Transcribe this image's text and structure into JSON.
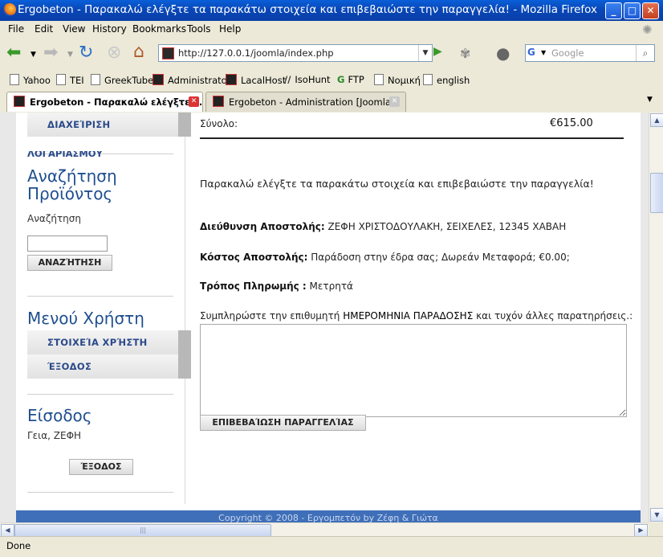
{
  "window": {
    "title": "Ergobeton - Παρακαλώ ελέγξτε τα παρακάτω στοιχεία και επιβεβαιώστε την παραγγελία! - Mozilla Firefox"
  },
  "menu": [
    "File",
    "Edit",
    "View",
    "History",
    "Bookmarks",
    "Tools",
    "Help"
  ],
  "toolbar": {
    "url": "http://127.0.0.1/joomla/index.php",
    "search_placeholder": "Google"
  },
  "bookmarks": [
    "Yahoo",
    "TEI",
    "GreekTube",
    "Administrator",
    "LacalHost",
    "IsoHunt",
    "FTP",
    "Νομική",
    "english"
  ],
  "tabs": [
    {
      "label": "Ergobeton - Παρακαλώ ελέγξτε τ...",
      "active": true
    },
    {
      "label": "Ergobeton - Administration [Joomla!]",
      "active": false
    }
  ],
  "sidebar": {
    "admin_label": "ΔΙΑΧΕΊΡΙΣΗ",
    "account_label": "ΛΟΓΑΡΙΑΣΜΟΥ",
    "search_title": "Αναζήτηση Προϊόντος",
    "search_label": "Αναζήτηση",
    "search_value": "",
    "search_button": "ΑΝΑΖΉΤΗΣΗ",
    "user_menu_title": "Μενού Χρήστη",
    "user_items": [
      "ΣΤΟΙΧΕΊΑ ΧΡΉΣΤΗ",
      "ΈΞΟΔΟΣ"
    ],
    "login_title": "Είσοδος",
    "greeting": "Γεια, ΖΕΦΗ",
    "logout_button": "ΈΞΟΔΟΣ"
  },
  "order": {
    "total_label": "Σύνολο:",
    "total_value": "€615.00",
    "confirm_message": "Παρακαλώ ελέγξτε τα παρακάτω στοιχεία και επιβεβαιώστε την παραγγελία!",
    "address_label": "Διεύθυνση Αποστολής:",
    "address_value": "ΖΕΦΗ ΧΡΙΣΤΟΔΟΥΛΑΚΗ, ΣΕΙΧΕΛΕΣ, 12345 ΧΑΒΑΗ",
    "shipping_label": "Κόστος Αποστολής:",
    "shipping_value": "Παράδοση στην έδρα σας; Δωρεάν Μεταφορά; €0.00;",
    "payment_label": "Τρόπος Πληρωμής :",
    "payment_value": "Μετρητά",
    "notes_prefix": "Συμπληρώστε την επιθυμητή",
    "notes_emphasis": "ΗΜΕΡΟΜΗΝΙΑ ΠΑΡΑΔΟΣΗΣ",
    "notes_suffix": "και τυχόν άλλες παρατηρήσεις.:",
    "notes_value": "",
    "confirm_button": "ΕΠΙΒΕΒΑΊΩΣΗ ΠΑΡΑΓΓΕΛΊΑΣ"
  },
  "footer": {
    "text": "Copyright © 2008 - Εργομπετόν by Ζέφη & Γιώτα"
  },
  "status": {
    "text": "Done"
  },
  "colors": {
    "titlebar": "#0847b8",
    "link_blue": "#1f4f8f",
    "footer": "#3f6fb8"
  }
}
